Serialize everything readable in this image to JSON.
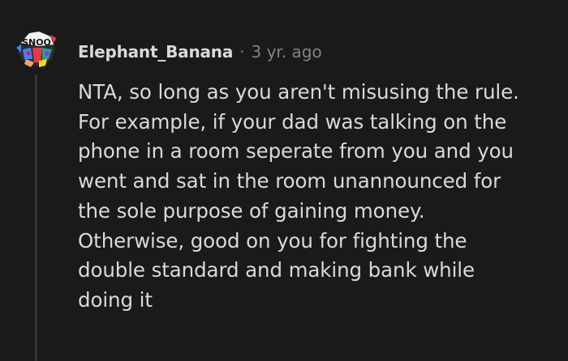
{
  "comment": {
    "username": "Elephant_Banana",
    "separator": "·",
    "timestamp": "3 yr. ago",
    "avatar_icon": "snoo-avatar-icon",
    "body_lines": [
      "NTA, so long as you aren't misusing the rule.",
      "For example, if your dad was talking on the",
      "phone in a room seperate from you and you",
      "went and sat in the room unannounced for",
      "the sole purpose of gaining money.",
      "Otherwise, good on you for fighting the",
      "double standard and making bank while",
      "doing it"
    ]
  },
  "colors": {
    "background": "#1a1a1b",
    "text": "#d7dadc",
    "meta": "#818384",
    "thread_line": "#343536"
  }
}
